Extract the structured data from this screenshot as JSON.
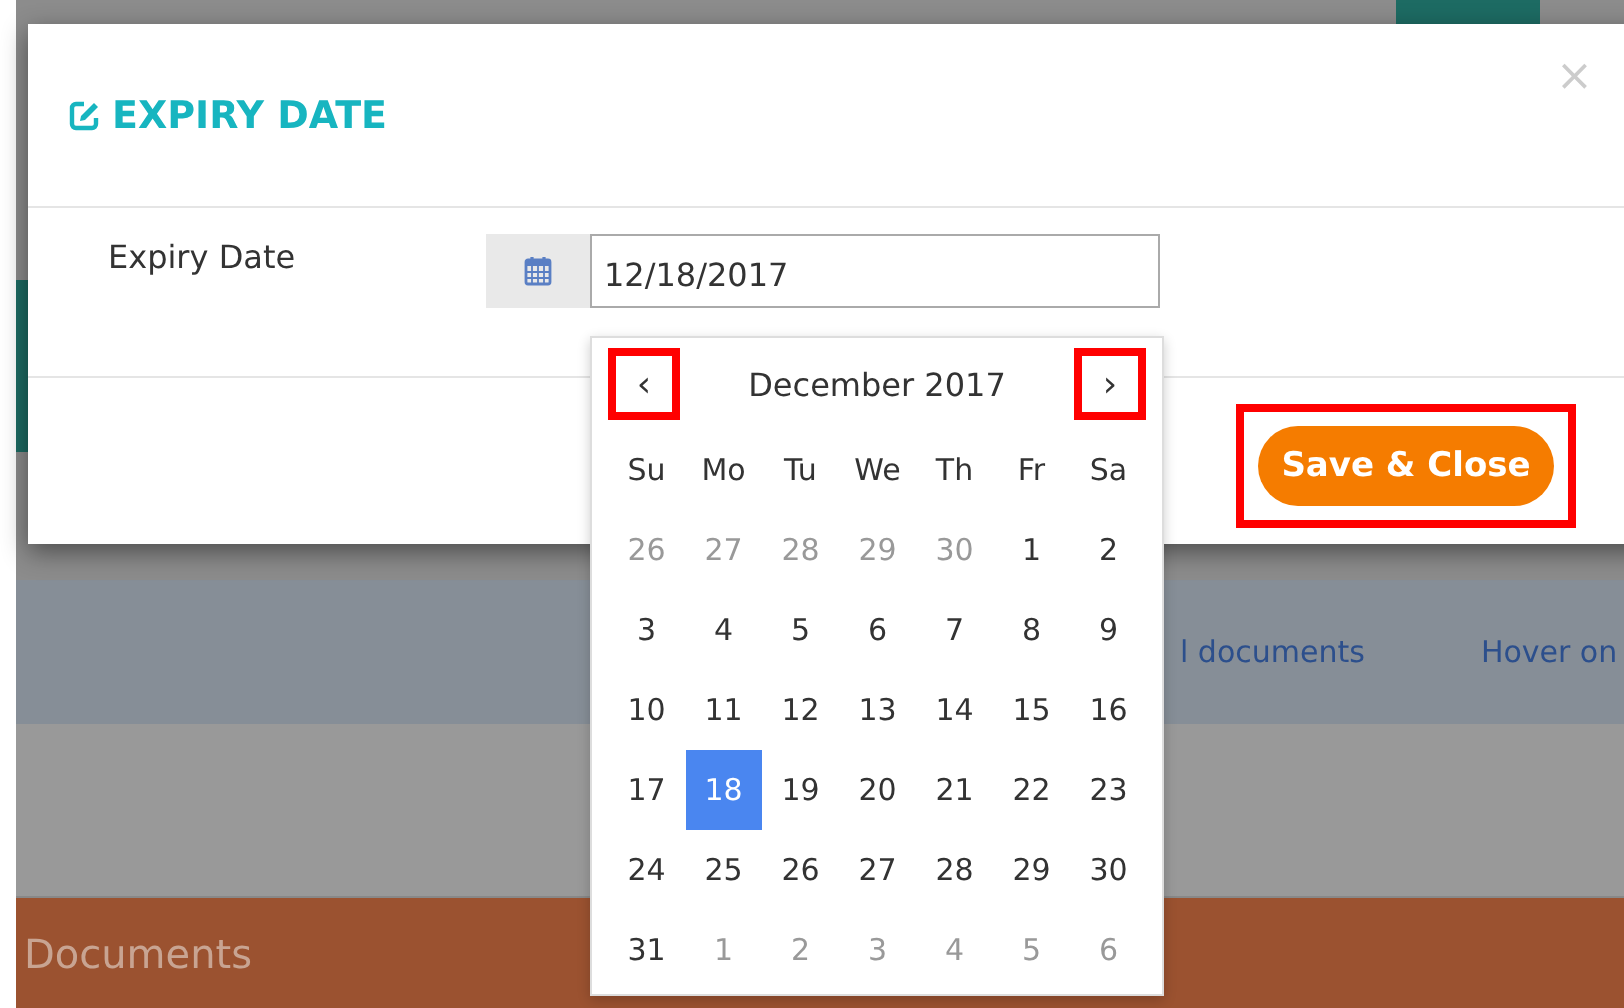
{
  "background": {
    "links": [
      "l documents",
      "Hover on"
    ],
    "section_title": "Documents"
  },
  "modal": {
    "title": "EXPIRY DATE",
    "close": "×",
    "field": {
      "label": "Expiry Date",
      "value": "12/18/2017"
    },
    "save_button": {
      "label": "Save & Close",
      "highlighted": true
    }
  },
  "datepicker": {
    "month": "December 2017",
    "prev": {
      "label": "‹",
      "highlighted": true
    },
    "next": {
      "label": "›",
      "highlighted": true
    },
    "weekdays": [
      "Su",
      "Mo",
      "Tu",
      "We",
      "Th",
      "Fr",
      "Sa"
    ],
    "days": [
      {
        "text": "26",
        "muted": true,
        "selected": false
      },
      {
        "text": "27",
        "muted": true,
        "selected": false
      },
      {
        "text": "28",
        "muted": true,
        "selected": false
      },
      {
        "text": "29",
        "muted": true,
        "selected": false
      },
      {
        "text": "30",
        "muted": true,
        "selected": false
      },
      {
        "text": "1",
        "muted": false,
        "selected": false
      },
      {
        "text": "2",
        "muted": false,
        "selected": false
      },
      {
        "text": "3",
        "muted": false,
        "selected": false
      },
      {
        "text": "4",
        "muted": false,
        "selected": false
      },
      {
        "text": "5",
        "muted": false,
        "selected": false
      },
      {
        "text": "6",
        "muted": false,
        "selected": false
      },
      {
        "text": "7",
        "muted": false,
        "selected": false
      },
      {
        "text": "8",
        "muted": false,
        "selected": false
      },
      {
        "text": "9",
        "muted": false,
        "selected": false
      },
      {
        "text": "10",
        "muted": false,
        "selected": false
      },
      {
        "text": "11",
        "muted": false,
        "selected": false
      },
      {
        "text": "12",
        "muted": false,
        "selected": false
      },
      {
        "text": "13",
        "muted": false,
        "selected": false
      },
      {
        "text": "14",
        "muted": false,
        "selected": false
      },
      {
        "text": "15",
        "muted": false,
        "selected": false
      },
      {
        "text": "16",
        "muted": false,
        "selected": false
      },
      {
        "text": "17",
        "muted": false,
        "selected": false
      },
      {
        "text": "18",
        "muted": false,
        "selected": true
      },
      {
        "text": "19",
        "muted": false,
        "selected": false
      },
      {
        "text": "20",
        "muted": false,
        "selected": false
      },
      {
        "text": "21",
        "muted": false,
        "selected": false
      },
      {
        "text": "22",
        "muted": false,
        "selected": false
      },
      {
        "text": "23",
        "muted": false,
        "selected": false
      },
      {
        "text": "24",
        "muted": false,
        "selected": false
      },
      {
        "text": "25",
        "muted": false,
        "selected": false
      },
      {
        "text": "26",
        "muted": false,
        "selected": false
      },
      {
        "text": "27",
        "muted": false,
        "selected": false
      },
      {
        "text": "28",
        "muted": false,
        "selected": false
      },
      {
        "text": "29",
        "muted": false,
        "selected": false
      },
      {
        "text": "30",
        "muted": false,
        "selected": false
      },
      {
        "text": "31",
        "muted": false,
        "selected": false
      },
      {
        "text": "1",
        "muted": true,
        "selected": false
      },
      {
        "text": "2",
        "muted": true,
        "selected": false
      },
      {
        "text": "3",
        "muted": true,
        "selected": false
      },
      {
        "text": "4",
        "muted": true,
        "selected": false
      },
      {
        "text": "5",
        "muted": true,
        "selected": false
      },
      {
        "text": "6",
        "muted": true,
        "selected": false
      }
    ]
  }
}
